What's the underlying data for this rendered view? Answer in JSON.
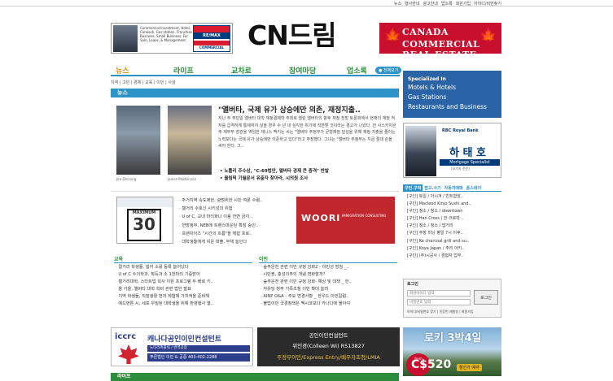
{
  "top_links": [
    "뉴스",
    "행사안내",
    "광고안내",
    "업소록",
    "회원가입",
    "아이디/비번찾기"
  ],
  "logo": "CN드림",
  "ad_left": {
    "text": "Commercial Investment, Hotel, Carwash, Gas station, Franchise Business, Small Business, For Sale, Lease, & Management",
    "badge_top": "RE/MAX",
    "badge_bottom": "COMMERCIAL"
  },
  "ad_right": {
    "line1": "CANADA",
    "line2": "COMMERCIAL REAL ESTATE"
  },
  "nav": [
    "뉴스",
    "라이프",
    "교차로",
    "참여마당",
    "업소록"
  ],
  "globe_button": "전체보기",
  "subnav": "지역 | 고민 | 경제 | 교육 | 이민 | 사설",
  "news_bar": "뉴스",
  "lead": {
    "caption1": "Jim Denning",
    "caption2": "Janice MacKinnon",
    "headline": "\"앨버타, 국제 유가 상승에만 의존, 재정지출..",
    "body": "지난 주 주민일 앨버타 대학 재정경제학 주최로 열린 앨버타의 향후 재정 전망 토론회에서 현재의 재정 적자를 급격하게 통제하지 않을 경우 수 년 내 심각한 위기에 직면할 것이라는 경고가 나왔다. 전 사스카치완 주 재무부 장관을 역임한 재니스 맥키논 씨는 \"앨버타 주정부가 균형재정 달성을 위해 재정 지출을 줄이는 노력보다는 국제 유가 상승에만 의존하고 있다\"라고 주장했다. 그녀는 \"앨버타 주정부는 지금 절대 손을 써야 한다. 그..",
    "bullets": [
      "노틀리 주수상, \"C-69법안, 앨버타 경제 큰 충격\" 반발",
      "올림픽 기월문서 유출자 찾아라, 시의원 조사"
    ]
  },
  "mid_list": [
    "주거지역 속도제한, 광범위한 시민 여론 수렴..",
    "캘거리 수호신 시키성의 위험",
    "U of C, 교내 마리화나 이용 전면 금지 ..",
    "연방정부, NEB에 트랜스마운틴 확장 승인..",
    "프랜차이즈 \"시간의 흐름\"을 체험 프로..",
    "대학생들에게 쉬운 대출, 부채 늘인다"
  ],
  "speed_sign": {
    "label": "MAXIMUM",
    "number": "30"
  },
  "woori_ad": {
    "name": "WOORI",
    "sub": "IMMIGRATION CONSULTING"
  },
  "education": {
    "heading": "교육",
    "items": [
      "컬거리 학생들, 쉽어 소를 등록 늘어났다",
      "U of C 수의학과, 획득과 소 1천마리 기증받아",
      "캘거리대학, 스타트업 회사 지원 프로그램 두 배로 키..",
      "올 가을, 앨버타 대학 학비 관련 법안 발표",
      "지역 학생들, 직장생활 먼저 체험해 가치적을 준비해",
      "에드먼튼 시, 세포 우밀된 대학생을 위해 환영행사 열.."
    ]
  },
  "immigration": {
    "heading": "이민",
    "items": [
      "숲주운전 관련 이민 규정 강화2 - 이민성 방침 _..",
      "시민권, 충성의주의 개념 변화할까?",
      "숲주운전 관련 이민 규정 강화- 예상 및 대책 _ 한..",
      "자유당 정부 가족초청 이민 확대 늘려",
      "AINP O&A - 주요 변경사항 _ 한우드 이민칼럼..",
      "불법이민 국경정책은 멕시코보다 카나다에 몰아야"
    ]
  },
  "banner_iccrc": {
    "logo": "iccrc",
    "title": "캐나다공인이민컨설턴트",
    "row1": "노타리퍼블릭 / 번역공증",
    "row2": "푸른법인 이민 & 공증 403-402-2288"
  },
  "banner_consult": {
    "line1": "공인이민컨설턴트",
    "line2": "위인경(Colleen Wi) R513827",
    "line3": "주정부이민/Express Entry/배우자초청/LMIA"
  },
  "bottom_bar": "라이프",
  "side_ad1": {
    "label": "Specialized In",
    "items": [
      "Motels & Hotels",
      "Gas Stations",
      "Restaurants and Business"
    ]
  },
  "side_ad2": {
    "bank": "RBC Royal Bank",
    "name": "하 태 호",
    "role": "Mortgage Specialist",
    "sub": "(모기지 전문)"
  },
  "side_tabs": [
    "구인.구직",
    "팝고.사기",
    "자동차매매",
    "홈스테이"
  ],
  "side_list": [
    "[구인] 토일 / 아시겨 / 빈트함앞..",
    "[구인] Macleod Kinjo Sushi and..",
    "[구인] 청소 / 청소 / downtown",
    "[구인] Han Cross | 한 크로마 ..",
    "[구인] 청소 / 청소 / 밥거리",
    "[구인] 주장 미닝 평일 7시 이후..",
    "[구인] Ke charcoal grill and su..",
    "[구인] Koya Japan / 주리 아키..",
    "[구인] (주)시공사 / 경험자 업무.."
  ],
  "login": {
    "title": "로그인",
    "id_placeholder": "회원아이디 입력",
    "pw_placeholder": "비밀번호 입력",
    "button": "로그인",
    "links": "아이디/비밀번호 찾기 | 인증번 재발송 | 회원가입"
  },
  "side_ad3": {
    "headline": "로키 3박4일",
    "from": "from",
    "price": "C$520",
    "cta": "할인가 예약"
  }
}
